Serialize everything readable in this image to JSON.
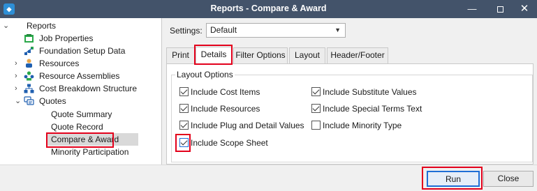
{
  "window": {
    "title": "Reports - Compare & Award",
    "app_icon": "app-icon",
    "min_label": "—",
    "close_label": "✕"
  },
  "tree": {
    "root": {
      "label": "Reports",
      "expanded": true
    },
    "items": [
      {
        "label": "Job Properties",
        "icon": "job-properties-icon",
        "expandable": false
      },
      {
        "label": "Foundation Setup Data",
        "icon": "foundation-setup-icon",
        "expandable": false
      },
      {
        "label": "Resources",
        "icon": "resources-icon",
        "expandable": true,
        "expanded": false
      },
      {
        "label": "Resource Assemblies",
        "icon": "resource-assemblies-icon",
        "expandable": true,
        "expanded": false
      },
      {
        "label": "Cost Breakdown Structure",
        "icon": "cost-breakdown-icon",
        "expandable": true,
        "expanded": false
      },
      {
        "label": "Quotes",
        "icon": "quotes-icon",
        "expandable": true,
        "expanded": true
      }
    ],
    "quote_children": [
      {
        "label": "Quote Summary",
        "selected": false
      },
      {
        "label": "Quote Record",
        "selected": false
      },
      {
        "label": "Compare & Award",
        "selected": true
      },
      {
        "label": "Minority Participation",
        "selected": false
      }
    ]
  },
  "settings": {
    "label": "Settings:",
    "value": "Default"
  },
  "tabs": [
    {
      "label": "Print",
      "active": false
    },
    {
      "label": "Details",
      "active": true
    },
    {
      "label": "Filter Options",
      "active": false
    },
    {
      "label": "Layout",
      "active": false
    },
    {
      "label": "Header/Footer",
      "active": false
    }
  ],
  "layout_options": {
    "title": "Layout Options",
    "left": [
      {
        "label": "Include Cost Items",
        "checked": true
      },
      {
        "label": "Include Resources",
        "checked": true
      },
      {
        "label": "Include Plug and Detail Values",
        "checked": true
      },
      {
        "label": "Include Scope Sheet",
        "checked": true
      }
    ],
    "right": [
      {
        "label": "Include Substitute Values",
        "checked": true
      },
      {
        "label": "Include Special Terms Text",
        "checked": true
      },
      {
        "label": "Include Minority Type",
        "checked": false
      }
    ]
  },
  "buttons": {
    "run": "Run",
    "close": "Close"
  },
  "colors": {
    "titlebar": "#43536a",
    "highlight": "#e3001b",
    "focus": "#1e6ed6"
  }
}
